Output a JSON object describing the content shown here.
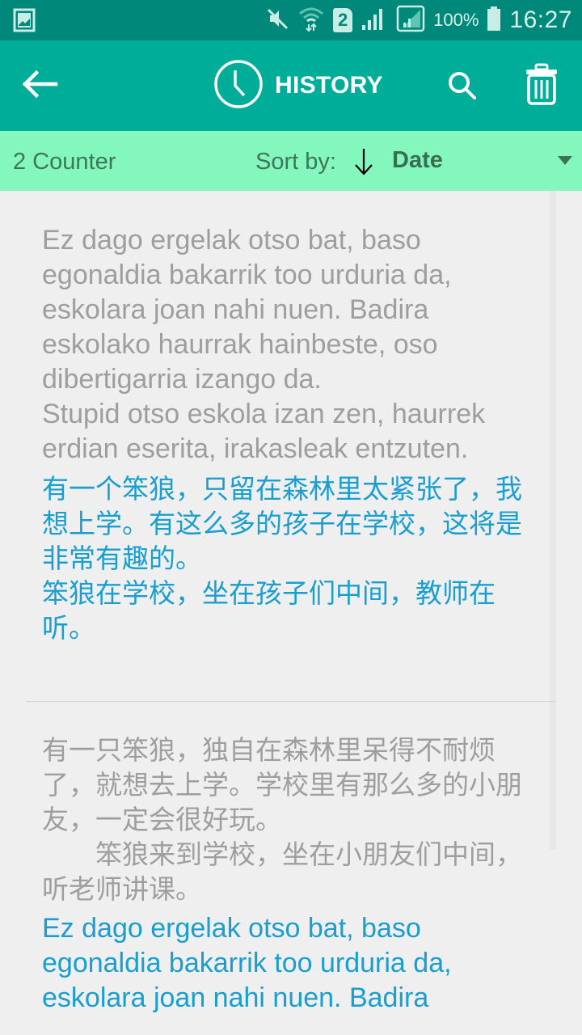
{
  "status_bar": {
    "left_icon": "gallery-icon",
    "icons": [
      "mute-icon",
      "wifi-icon",
      "sim-2-icon",
      "signal-icon",
      "signal-2-icon",
      "battery-icon"
    ],
    "sim_label": "2",
    "battery": "100%",
    "time": "16:27"
  },
  "toolbar": {
    "back_icon": "arrow-left-icon",
    "title_icon": "clock-icon",
    "title": "HISTORY",
    "search_icon": "search-icon",
    "delete_icon": "trash-icon"
  },
  "sort_bar": {
    "counter": "2 Counter",
    "sort_label": "Sort by:",
    "sort_direction_icon": "arrow-down-icon",
    "sort_value": "Date",
    "dropdown_icon": "triangle-down-icon"
  },
  "colors": {
    "status_bar": "#00897B",
    "toolbar": "#00AD98",
    "sort_bar": "#84F7BE",
    "background": "#EFEFEF",
    "source_text": "#9E9E9E",
    "translated_text": "#1A9ECF"
  },
  "history": [
    {
      "source": "Ez dago ergelak otso bat, baso egonaldia bakarrik too urduria da, eskolara joan nahi nuen. Badira eskolako haurrak hainbeste, oso dibertigarria izango da.\nStupid otso eskola izan zen, haurrek erdian eserita, irakasleak entzuten.",
      "translation": "有一个笨狼，只留在森林里太紧张了，我想上学。有这么多的孩子在学校，这将是非常有趣的。\n笨狼在学校，坐在孩子们中间，教师在听。"
    },
    {
      "source": "有一只笨狼，独自在森林里呆得不耐烦了，就想去上学。学校里有那么多的小朋友，一定会很好玩。\n　　笨狼来到学校，坐在小朋友们中间，听老师讲课。",
      "translation": "Ez dago ergelak otso bat, baso egonaldia bakarrik too urduria da, eskolara joan nahi nuen. Badira"
    }
  ]
}
